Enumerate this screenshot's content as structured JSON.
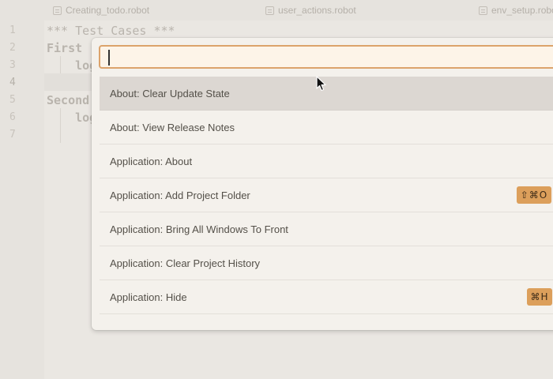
{
  "tabs": [
    {
      "label": "Creating_todo.robot"
    },
    {
      "label": "user_actions.robot"
    },
    {
      "label": "env_setup.robot"
    }
  ],
  "editor": {
    "line_numbers": [
      "1",
      "2",
      "3",
      "4",
      "5",
      "6",
      "7"
    ],
    "lines": [
      "*** Test Cases ***",
      "First",
      "    log",
      "",
      "Second",
      "    log",
      ""
    ]
  },
  "palette": {
    "search_value": "",
    "items": [
      {
        "label": "About: Clear Update State",
        "shortcut": ""
      },
      {
        "label": "About: View Release Notes",
        "shortcut": ""
      },
      {
        "label": "Application: About",
        "shortcut": ""
      },
      {
        "label": "Application: Add Project Folder",
        "shortcut": "⇧⌘O"
      },
      {
        "label": "Application: Bring All Windows To Front",
        "shortcut": ""
      },
      {
        "label": "Application: Clear Project History",
        "shortcut": ""
      },
      {
        "label": "Application: Hide",
        "shortcut": "⌘H"
      },
      {
        "label": "",
        "shortcut": ""
      }
    ],
    "selected_index": 0
  },
  "colors": {
    "accent": "#dca36b",
    "shortcut_badge": "#dc9f5b",
    "selected_row": "#dcd7d2"
  }
}
